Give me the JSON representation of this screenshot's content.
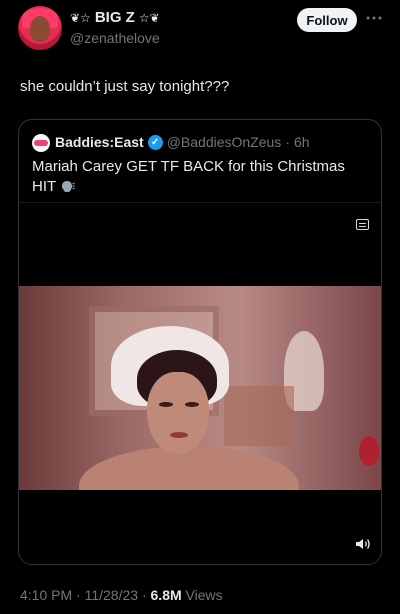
{
  "author": {
    "display_name": "BIG Z",
    "decor_left": "❦☆",
    "decor_right": "☆❦",
    "handle": "@zenathelove"
  },
  "follow_label": "Follow",
  "more_icon": "more-icon",
  "tweet_text": "she couldn’t just say tonight???",
  "quoted": {
    "display_name": "Baddies:East",
    "verified": true,
    "handle": "@BaddiesOnZeus",
    "time": "6h",
    "text": "Mariah Carey GET TF BACK for this Christmas HIT"
  },
  "media": {
    "caption_icon": "captions-icon",
    "volume_icon": "volume-icon"
  },
  "meta": {
    "time": "4:10 PM",
    "date": "11/28/23",
    "views_count": "6.8M",
    "views_label": "Views"
  },
  "colors": {
    "background": "#000000",
    "text": "#e7e9ea",
    "muted": "#71767b",
    "verified": "#1d9bf0",
    "border": "#2f3336"
  }
}
